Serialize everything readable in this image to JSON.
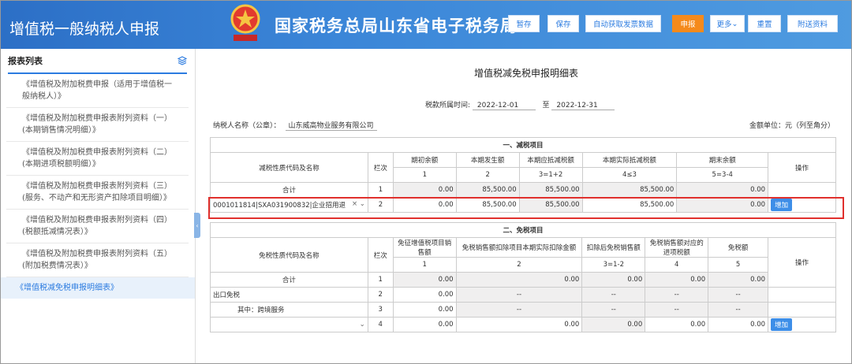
{
  "header": {
    "app_title": "增值税一般纳税人申报",
    "brand": "国家税务总局山东省电子税务局",
    "buttons": {
      "stash": "暂存",
      "save": "保存",
      "auto_invoice": "自动获取发票数据",
      "declare": "申报",
      "more": "更多",
      "reset": "重置",
      "attach": "附送资料"
    }
  },
  "sidebar": {
    "title": "报表列表",
    "items": [
      "《增值税及附加税费申报（适用于增值税一般纳税人）》",
      "《增值税及附加税费申报表附列资料（一）(本期销售情况明细）》",
      "《增值税及附加税费申报表附列资料（二）(本期进项税额明细）》",
      "《增值税及附加税费申报表附列资料（三）(服务、不动产和无形资产扣除项目明细）》",
      "《增值税及附加税费申报表附列资料（四）(税额抵减情况表）》",
      "《增值税及附加税费申报表附列资料（五）(附加税费情况表）》",
      "《增值税减免税申报明细表》"
    ]
  },
  "form": {
    "title": "增值税减免税申报明细表",
    "period_label": "税款所属时间:",
    "period_start": "2022-12-01",
    "period_to": "至",
    "period_end": "2022-12-31",
    "taxpayer_label": "纳税人名称（公章）：",
    "taxpayer": "山东威高物业服务有限公司",
    "unit": "金额单位：元（列至角分）"
  },
  "t1": {
    "section": "一、减税项目",
    "h_name": "减税性质代码及名称",
    "h_line": "栏次",
    "h_op": "操作",
    "cols": [
      "期初余额",
      "本期发生额",
      "本期应抵减税额",
      "本期实际抵减税额",
      "期末余额"
    ],
    "nums": [
      "1",
      "2",
      "3=1+2",
      "4≤3",
      "5=3-4"
    ],
    "rows": [
      {
        "name": "合计",
        "line": "1",
        "v": [
          "0.00",
          "85,500.00",
          "85,500.00",
          "85,500.00",
          "0.00"
        ]
      },
      {
        "name": "0001011814|SXA031900832|企业招用退",
        "line": "2",
        "v": [
          "0.00",
          "85,500.00",
          "85,500.00",
          "85,500.00",
          "0.00"
        ],
        "op": "增加"
      }
    ]
  },
  "t2": {
    "section": "二、免税项目",
    "h_name": "免税性质代码及名称",
    "h_line": "栏次",
    "h_op": "操作",
    "cols": [
      "免征增值税项目销售额",
      "免税销售额扣除项目本期实际扣除金额",
      "扣除后免税销售额",
      "免税销售额对应的进项税额",
      "免税额"
    ],
    "nums": [
      "1",
      "2",
      "3=1-2",
      "4",
      "5"
    ],
    "rows": [
      {
        "name": "合计",
        "line": "1",
        "v": [
          "0.00",
          "0.00",
          "0.00",
          "0.00",
          "0.00"
        ]
      },
      {
        "name": "出口免税",
        "line": "2",
        "v": [
          "0.00",
          "--",
          "--",
          "--",
          "--"
        ]
      },
      {
        "name": "其中：跨境服务",
        "line": "3",
        "v": [
          "0.00",
          "--",
          "--",
          "--",
          "--"
        ]
      },
      {
        "name": "",
        "line": "4",
        "v": [
          "0.00",
          "0.00",
          "0.00",
          "0.00",
          "0.00"
        ],
        "op": "增加"
      }
    ]
  }
}
